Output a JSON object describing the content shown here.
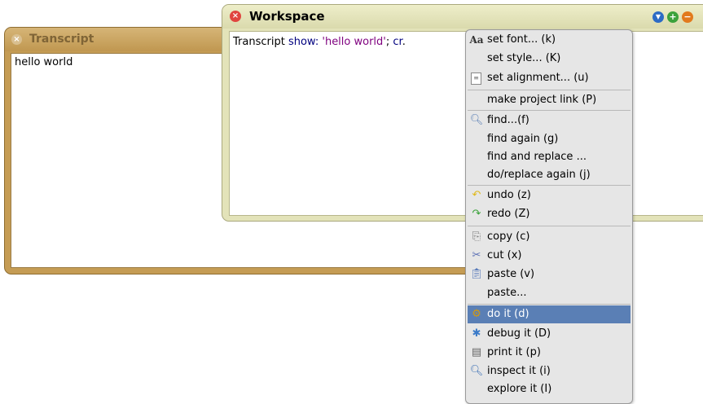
{
  "transcript": {
    "title": "Transcript",
    "close_icon": "×",
    "content": "hello world"
  },
  "workspace": {
    "title": "Workspace",
    "close_icon": "×",
    "buttons": {
      "menu": "▼",
      "expand": "+",
      "collapse": "−"
    },
    "code": {
      "receiver": "Transcript",
      "selector": "show:",
      "argument": "'hello world'",
      "sep": ";",
      "cr": "cr",
      "end": "."
    }
  },
  "menu": {
    "items": [
      {
        "label": "set font... (k)",
        "icon": "font-icon",
        "glyph": "Aa"
      },
      {
        "label": "set style... (K)",
        "icon": "",
        "glyph": ""
      },
      {
        "label": "set alignment... (u)",
        "icon": "document-icon",
        "glyph": "≡"
      },
      {
        "label": "make project link (P)",
        "icon": "",
        "glyph": ""
      },
      {
        "label": "find...(f)",
        "icon": "find-icon",
        "glyph": "🔍︎"
      },
      {
        "label": "find again (g)",
        "icon": "",
        "glyph": ""
      },
      {
        "label": "find and replace ...",
        "icon": "",
        "glyph": ""
      },
      {
        "label": "do/replace again (j)",
        "icon": "",
        "glyph": ""
      },
      {
        "label": "undo (z)",
        "icon": "undo-icon",
        "glyph": "↶"
      },
      {
        "label": "redo (Z)",
        "icon": "redo-icon",
        "glyph": "↷"
      },
      {
        "label": "copy (c)",
        "icon": "copy-icon",
        "glyph": "⎘"
      },
      {
        "label": "cut (x)",
        "icon": "scissors-icon",
        "glyph": "✂"
      },
      {
        "label": "paste (v)",
        "icon": "clipboard-icon",
        "glyph": "📋︎"
      },
      {
        "label": "paste...",
        "icon": "",
        "glyph": ""
      },
      {
        "label": "do it (d)",
        "icon": "gear-icon",
        "glyph": "⚙"
      },
      {
        "label": "debug it (D)",
        "icon": "bug-icon",
        "glyph": "✱"
      },
      {
        "label": "print it (p)",
        "icon": "printer-icon",
        "glyph": "▤"
      },
      {
        "label": "inspect it (i)",
        "icon": "magnifier-icon",
        "glyph": "🔍︎"
      },
      {
        "label": "explore it (I)",
        "icon": "",
        "glyph": ""
      }
    ],
    "selected_index": 14
  }
}
